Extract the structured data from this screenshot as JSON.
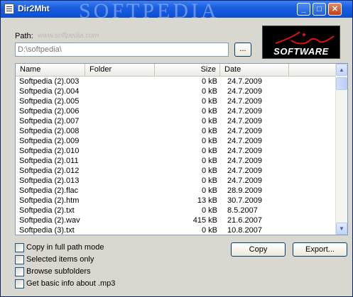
{
  "window": {
    "title": "Dir2Mht",
    "watermark": "SOFTPEDIA",
    "controls": {
      "minimize": "_",
      "maximize": "□",
      "close": "✕"
    }
  },
  "path": {
    "label": "Path:",
    "watermark_url": "www.softpedia.com",
    "value": "D:\\softpedia\\",
    "browse_label": "..."
  },
  "logo": {
    "text": "SOFTWARE"
  },
  "list": {
    "columns": {
      "name": "Name",
      "folder": "Folder",
      "size": "Size",
      "date": "Date"
    },
    "rows": [
      {
        "name": "Softpedia (2).003",
        "folder": "",
        "size": "0 kB",
        "date": "24.7.2009"
      },
      {
        "name": "Softpedia (2).004",
        "folder": "",
        "size": "0 kB",
        "date": "24.7.2009"
      },
      {
        "name": "Softpedia (2).005",
        "folder": "",
        "size": "0 kB",
        "date": "24.7.2009"
      },
      {
        "name": "Softpedia (2).006",
        "folder": "",
        "size": "0 kB",
        "date": "24.7.2009"
      },
      {
        "name": "Softpedia (2).007",
        "folder": "",
        "size": "0 kB",
        "date": "24.7.2009"
      },
      {
        "name": "Softpedia (2).008",
        "folder": "",
        "size": "0 kB",
        "date": "24.7.2009"
      },
      {
        "name": "Softpedia (2).009",
        "folder": "",
        "size": "0 kB",
        "date": "24.7.2009"
      },
      {
        "name": "Softpedia (2).010",
        "folder": "",
        "size": "0 kB",
        "date": "24.7.2009"
      },
      {
        "name": "Softpedia (2).011",
        "folder": "",
        "size": "0 kB",
        "date": "24.7.2009"
      },
      {
        "name": "Softpedia (2).012",
        "folder": "",
        "size": "0 kB",
        "date": "24.7.2009"
      },
      {
        "name": "Softpedia (2).013",
        "folder": "",
        "size": "0 kB",
        "date": "24.7.2009"
      },
      {
        "name": "Softpedia (2).flac",
        "folder": "",
        "size": "0 kB",
        "date": "28.9.2009"
      },
      {
        "name": "Softpedia (2).htm",
        "folder": "",
        "size": "13 kB",
        "date": "30.7.2009"
      },
      {
        "name": "Softpedia (2).txt",
        "folder": "",
        "size": "0 kB",
        "date": "8.5.2007"
      },
      {
        "name": "Softpedia (2).wav",
        "folder": "",
        "size": "415 kB",
        "date": "21.6.2007"
      },
      {
        "name": "Softpedia (3).txt",
        "folder": "",
        "size": "0 kB",
        "date": "10.8.2007"
      }
    ]
  },
  "options": [
    {
      "label": "Copy in full path mode"
    },
    {
      "label": "Selected items only"
    },
    {
      "label": "Browse subfolders"
    },
    {
      "label": "Get basic info about .mp3"
    }
  ],
  "actions": {
    "copy": "Copy",
    "export": "Export..."
  }
}
